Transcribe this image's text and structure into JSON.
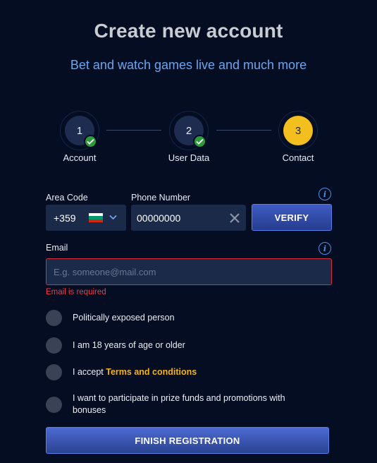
{
  "header": {
    "title": "Create new account",
    "subtitle": "Bet and watch games live and much more"
  },
  "stepper": {
    "steps": [
      {
        "number": "1",
        "label": "Account",
        "status": "completed"
      },
      {
        "number": "2",
        "label": "User Data",
        "status": "completed"
      },
      {
        "number": "3",
        "label": "Contact",
        "status": "active"
      }
    ]
  },
  "phone": {
    "area_label": "Area Code",
    "area_value": "+359",
    "flag": "bulgaria-flag",
    "number_label": "Phone Number",
    "number_value": "00000000",
    "verify_label": "VERIFY"
  },
  "email": {
    "label": "Email",
    "placeholder": "E.g. someone@mail.com",
    "value": "",
    "error": "Email is required"
  },
  "checkboxes": {
    "pep": "Politically exposed person",
    "age": "I am 18 years of age or older",
    "terms_prefix": "I accept ",
    "terms_link": "Terms and conditions",
    "promo": "I want to participate in prize funds and promotions with bonuses"
  },
  "actions": {
    "finish_label": "FINISH REGISTRATION"
  },
  "colors": {
    "background": "#050d22",
    "accent_blue": "#3f5cc4",
    "step_active": "#f2bf1e",
    "step_done": "#2e9a3c",
    "error": "#ef3b45",
    "link": "#f2b41e"
  }
}
